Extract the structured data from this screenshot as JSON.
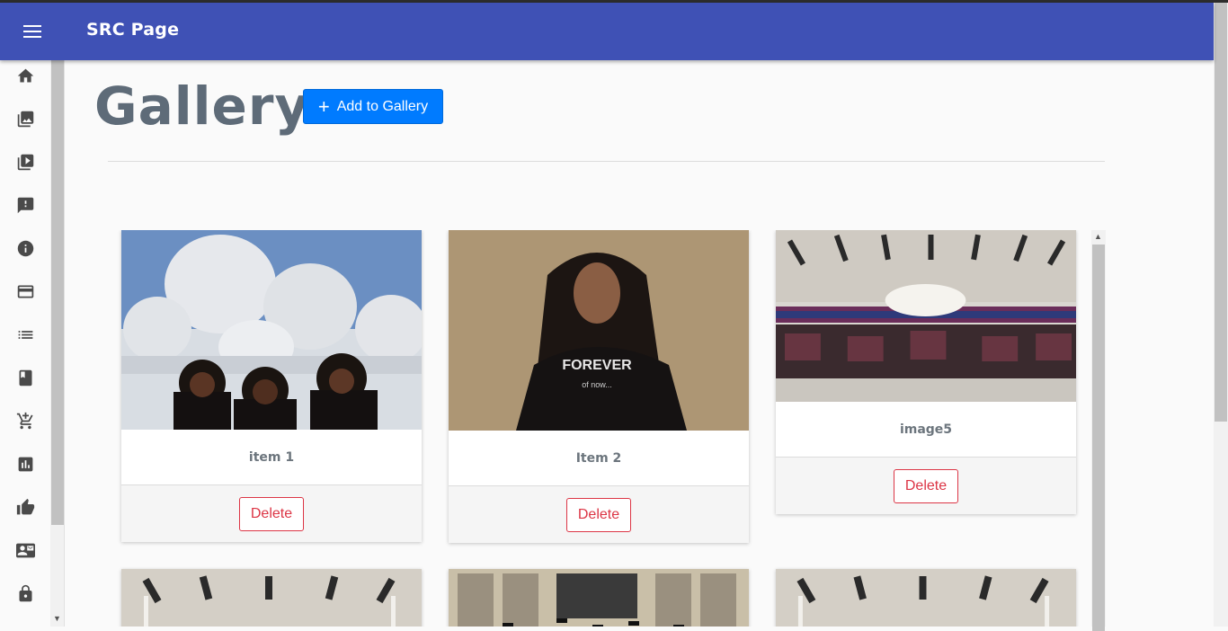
{
  "app": {
    "title": "SRC Page"
  },
  "sidebar": {
    "items": [
      {
        "name": "home-icon"
      },
      {
        "name": "photo-library-icon"
      },
      {
        "name": "video-library-icon"
      },
      {
        "name": "feedback-icon"
      },
      {
        "name": "info-icon"
      },
      {
        "name": "credit-card-icon"
      },
      {
        "name": "list-icon"
      },
      {
        "name": "book-icon"
      },
      {
        "name": "add-shopping-cart-icon"
      },
      {
        "name": "poll-icon"
      },
      {
        "name": "thumb-up-icon"
      },
      {
        "name": "contact-mail-icon"
      },
      {
        "name": "lock-icon"
      }
    ]
  },
  "page": {
    "title": "Gallery",
    "add_button_label": "Add to Gallery"
  },
  "gallery": {
    "delete_label": "Delete",
    "cards": [
      {
        "caption": "item 1",
        "image": "women-in-hijab-before-mosque"
      },
      {
        "caption": "Item 2",
        "image": "woman-in-forever-tshirt"
      },
      {
        "caption": "image5",
        "image": "graduation-hall-crowd"
      },
      {
        "caption": "",
        "image": "graduation-hall-ceiling"
      },
      {
        "caption": "",
        "image": "graduation-caps-thrown"
      },
      {
        "caption": "",
        "image": "graduation-hall-ceiling"
      }
    ]
  },
  "colors": {
    "appbar": "#3f51b5",
    "primary_button": "#007bff",
    "danger": "#dc3545",
    "title_text": "#5e6b78"
  }
}
